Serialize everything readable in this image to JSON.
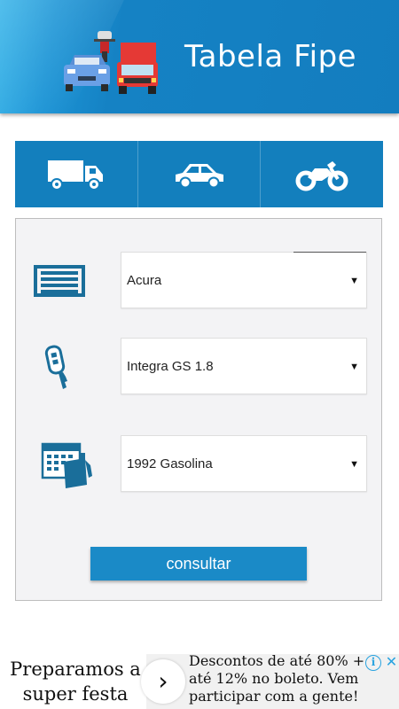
{
  "header": {
    "title": "Tabela Fipe"
  },
  "tabs": [
    {
      "name": "truck",
      "icon": "truck-icon"
    },
    {
      "name": "car",
      "icon": "car-icon"
    },
    {
      "name": "motorcycle",
      "icon": "motorcycle-icon"
    }
  ],
  "form": {
    "brand": {
      "value": "Acura",
      "icon": "garage-icon"
    },
    "model": {
      "value": "Integra GS 1.8",
      "icon": "car-key-icon"
    },
    "year": {
      "value": "1992 Gasolina",
      "icon": "calendar-fuel-icon"
    },
    "submit_label": "consultar"
  },
  "ad": {
    "left_text": "Preparamos a super festa",
    "right_text": "Descontos de até 80% + até 12% no boleto. Vem participar com a gente!",
    "arrow": "›"
  },
  "colors": {
    "primary": "#137fbd",
    "button": "#1a8ac7",
    "panel_bg": "#f3f3f5"
  }
}
